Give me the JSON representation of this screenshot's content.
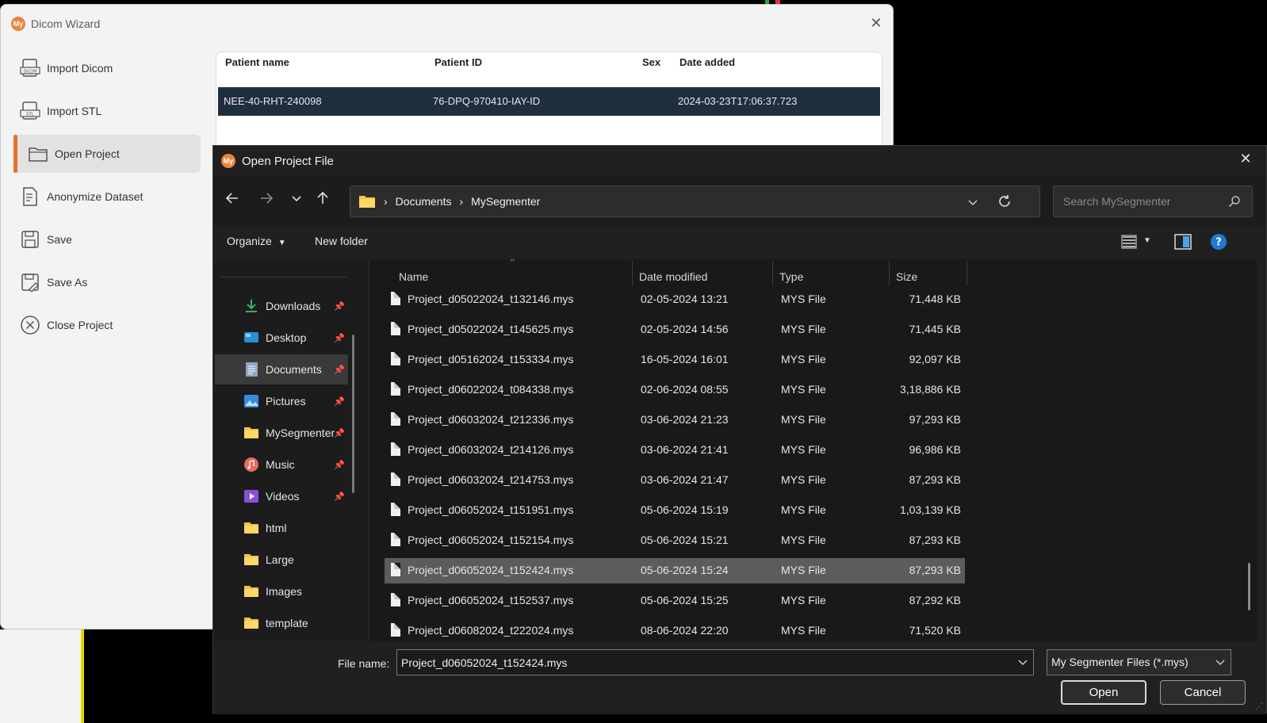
{
  "wizard": {
    "title": "Dicom Wizard",
    "logo_text": "My",
    "close_glyph": "✕",
    "menu": [
      {
        "label": "Import Dicom",
        "icon": "dicom-file-icon"
      },
      {
        "label": "Import STL",
        "icon": "stl-file-icon"
      },
      {
        "label": "Open Project",
        "icon": "folder-icon",
        "active": true
      },
      {
        "label": "Anonymize Dataset",
        "icon": "document-edit-icon"
      },
      {
        "label": "Save",
        "icon": "save-icon"
      },
      {
        "label": "Save As",
        "icon": "save-as-icon"
      },
      {
        "label": "Close Project",
        "icon": "close-circle-icon"
      }
    ],
    "table": {
      "headers": [
        "Patient name",
        "Patient ID",
        "Sex",
        "Date added"
      ],
      "row": {
        "name": "NEE-40-RHT-240098",
        "id": "76-DPQ-970410-IAY-ID",
        "sex": "",
        "date": "2024-03-23T17:06:37.723"
      }
    }
  },
  "dialog": {
    "title": "Open Project File",
    "logo_text": "My",
    "close_glyph": "✕",
    "breadcrumb": [
      "Documents",
      "MySegmenter"
    ],
    "search_placeholder": "Search MySegmenter",
    "toolbar": {
      "organize": "Organize",
      "new_folder": "New folder"
    },
    "nav_items": [
      {
        "label": "Downloads",
        "icon": "download-icon",
        "pinned": true
      },
      {
        "label": "Desktop",
        "icon": "desktop-icon",
        "pinned": true
      },
      {
        "label": "Documents",
        "icon": "documents-icon",
        "pinned": true,
        "selected": true
      },
      {
        "label": "Pictures",
        "icon": "pictures-icon",
        "pinned": true
      },
      {
        "label": "MySegmenter",
        "icon": "folder-icon",
        "pinned": true
      },
      {
        "label": "Music",
        "icon": "music-icon",
        "pinned": true
      },
      {
        "label": "Videos",
        "icon": "videos-icon",
        "pinned": true
      },
      {
        "label": "html",
        "icon": "folder-icon"
      },
      {
        "label": "Large",
        "icon": "folder-icon"
      },
      {
        "label": "Images",
        "icon": "folder-icon"
      },
      {
        "label": "template",
        "icon": "folder-icon"
      }
    ],
    "columns": [
      "Name",
      "Date modified",
      "Type",
      "Size"
    ],
    "files": [
      {
        "name": "Project_d05022024_t132146.mys",
        "date": "02-05-2024 13:21",
        "type": "MYS File",
        "size": "71,448 KB"
      },
      {
        "name": "Project_d05022024_t145625.mys",
        "date": "02-05-2024 14:56",
        "type": "MYS File",
        "size": "71,445 KB"
      },
      {
        "name": "Project_d05162024_t153334.mys",
        "date": "16-05-2024 16:01",
        "type": "MYS File",
        "size": "92,097 KB"
      },
      {
        "name": "Project_d06022024_t084338.mys",
        "date": "02-06-2024 08:55",
        "type": "MYS File",
        "size": "3,18,886 KB"
      },
      {
        "name": "Project_d06032024_t212336.mys",
        "date": "03-06-2024 21:23",
        "type": "MYS File",
        "size": "97,293 KB"
      },
      {
        "name": "Project_d06032024_t214126.mys",
        "date": "03-06-2024 21:41",
        "type": "MYS File",
        "size": "96,986 KB"
      },
      {
        "name": "Project_d06032024_t214753.mys",
        "date": "03-06-2024 21:47",
        "type": "MYS File",
        "size": "87,293 KB"
      },
      {
        "name": "Project_d06052024_t151951.mys",
        "date": "05-06-2024 15:19",
        "type": "MYS File",
        "size": "1,03,139 KB"
      },
      {
        "name": "Project_d06052024_t152154.mys",
        "date": "05-06-2024 15:21",
        "type": "MYS File",
        "size": "87,293 KB"
      },
      {
        "name": "Project_d06052024_t152424.mys",
        "date": "05-06-2024 15:24",
        "type": "MYS File",
        "size": "87,293 KB",
        "selected": true
      },
      {
        "name": "Project_d06052024_t152537.mys",
        "date": "05-06-2024 15:25",
        "type": "MYS File",
        "size": "87,292 KB"
      },
      {
        "name": "Project_d06082024_t222024.mys",
        "date": "08-06-2024 22:20",
        "type": "MYS File",
        "size": "71,520 KB"
      }
    ],
    "file_name_label": "File name:",
    "file_name_value": "Project_d06052024_t152424.mys",
    "file_type_value": "My Segmenter Files (*.mys)",
    "open_label": "Open",
    "cancel_label": "Cancel"
  },
  "colors": {
    "accent": "#e8702f",
    "selected_row": "#1f2e3d",
    "dialog_bg": "#202020"
  }
}
